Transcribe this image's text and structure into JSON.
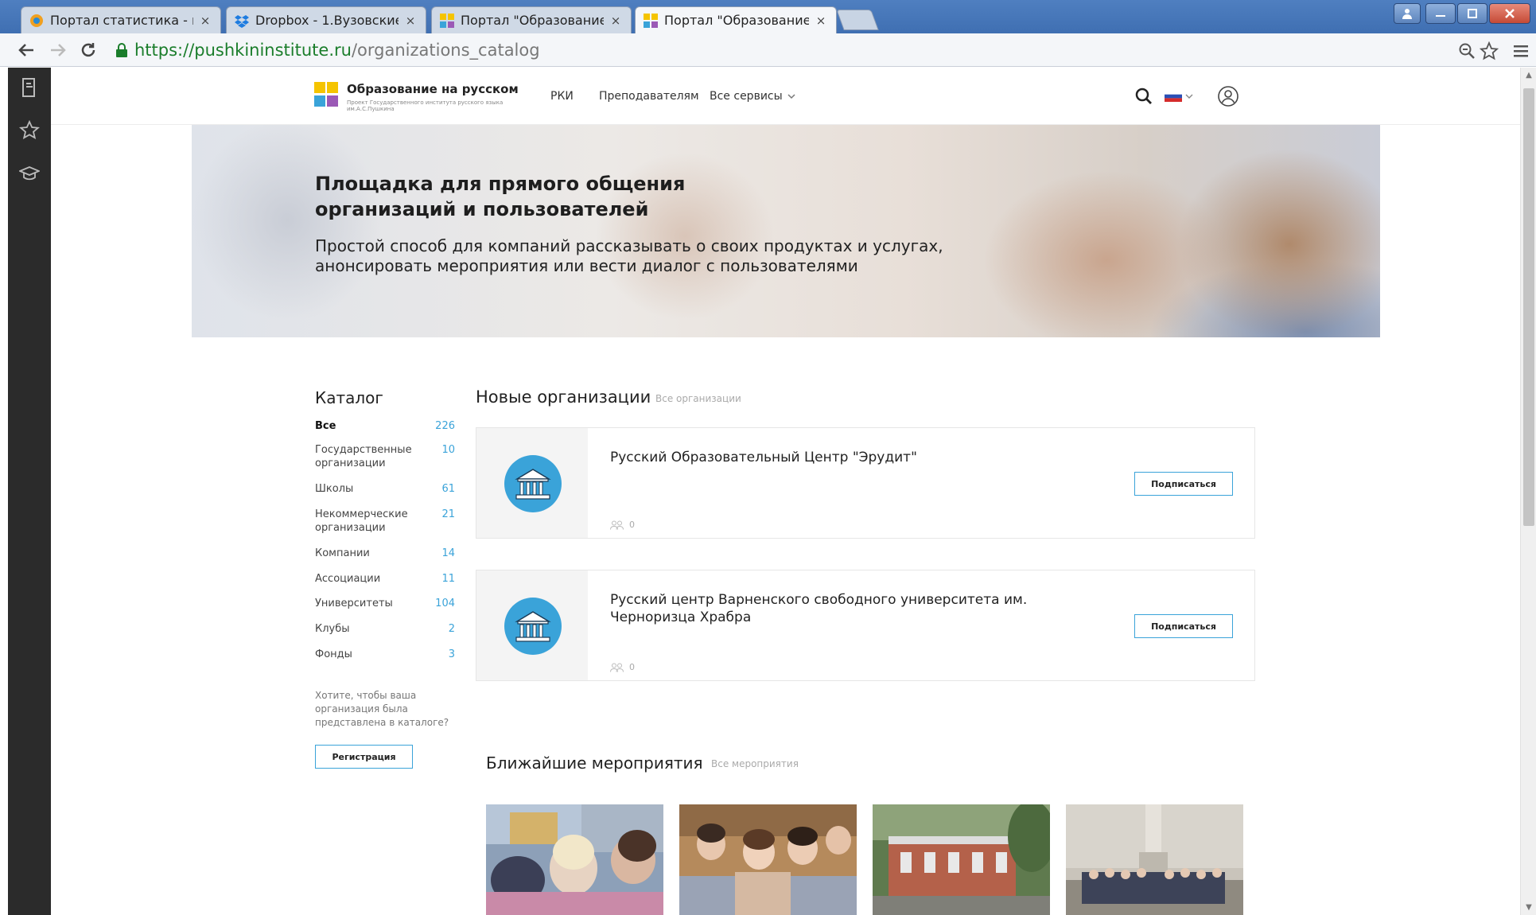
{
  "browser": {
    "tabs": [
      {
        "label": "Портал статистика - mi_y",
        "icon": "stats-globe-icon",
        "active": false
      },
      {
        "label": "Dropbox - 1.Вузовские вы",
        "icon": "dropbox-icon",
        "active": false
      },
      {
        "label": "Портал \"Образование на",
        "icon": "portal-logo-icon",
        "active": false
      },
      {
        "label": "Портал \"Образование на",
        "icon": "portal-logo-icon",
        "active": true
      }
    ],
    "tab_close_glyph": "×",
    "url_host": "https://pushkininstitute.ru",
    "url_path": "/organizations_catalog",
    "colors": {
      "secure_url": "#1a7d2b",
      "tabbar": "#4f7fc0"
    }
  },
  "header": {
    "brand_title": "Образование на русском",
    "brand_subtitle": "Проект Государственного института русского языка им.А.С.Пушкина",
    "nav": {
      "rki": "РКИ",
      "teachers": "Преподавателям",
      "all_services": "Все сервисы"
    },
    "colors": {
      "logo_yellow": "#f5c400",
      "logo_blue": "#3aa3d9",
      "logo_purple": "#9b59b6"
    }
  },
  "hero": {
    "title": "Площадка для прямого общения организаций и пользователей",
    "subtitle": "Простой способ для компаний рассказывать о своих продуктах и услугах, анонсировать мероприятия или вести диалог с пользователями"
  },
  "catalog": {
    "title": "Каталог",
    "items": [
      {
        "label": "Все",
        "count": "226"
      },
      {
        "label": "Государственные организации",
        "count": "10"
      },
      {
        "label": "Школы",
        "count": "61"
      },
      {
        "label": "Некоммерческие организации",
        "count": "21"
      },
      {
        "label": "Компании",
        "count": "14"
      },
      {
        "label": "Ассоциации",
        "count": "11"
      },
      {
        "label": "Университеты",
        "count": "104"
      },
      {
        "label": "Клубы",
        "count": "2"
      },
      {
        "label": "Фонды",
        "count": "3"
      }
    ],
    "register_note": "Хотите, чтобы ваша организация была представлена в каталоге?",
    "register_button": "Регистрация",
    "accent": "#3aa3d9"
  },
  "organizations": {
    "title": "Новые организации",
    "all_link": "Все организации",
    "items": [
      {
        "name": "Русский Образовательный Центр \"Эрудит\"",
        "subscribers": "0",
        "subscribe_label": "Подписаться"
      },
      {
        "name": "Русский центр Варненского свободного университета им. Черноризца Храбра",
        "subscribers": "0",
        "subscribe_label": "Подписаться"
      }
    ]
  },
  "events": {
    "title": "Ближайшие мероприятия",
    "all_link": "Все мероприятия"
  }
}
